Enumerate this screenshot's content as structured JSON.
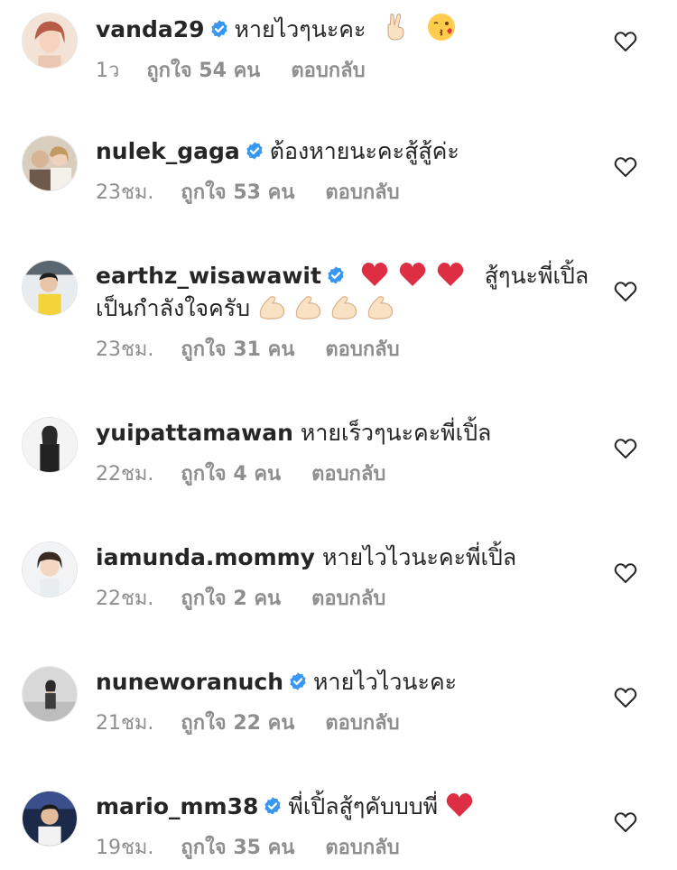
{
  "comments": [
    {
      "username": "vanda29",
      "verified": true,
      "text": "หายไวๆนะคะ",
      "emojis": [
        "victory-hand",
        "kiss-face"
      ],
      "time": "1ว",
      "likes": "ถูกใจ 54 คน",
      "reply": "ตอบกลับ"
    },
    {
      "username": "nulek_gaga",
      "verified": true,
      "text": "ต้องหายนะคะสู้สู้ค่ะ",
      "emojis": [],
      "time": "23ชม.",
      "likes": "ถูกใจ 53 คน",
      "reply": "ตอบกลับ"
    },
    {
      "username": "earthz_wisawawit",
      "verified": true,
      "text": "สู้ๆนะพี่เปิ้ล",
      "text_line2": "เป็นกำลังใจครับ",
      "emojis": [
        "red-heart",
        "red-heart",
        "red-heart"
      ],
      "emojis_line2": [
        "flexed-biceps",
        "flexed-biceps",
        "flexed-biceps",
        "flexed-biceps"
      ],
      "time": "23ชม.",
      "likes": "ถูกใจ 31 คน",
      "reply": "ตอบกลับ"
    },
    {
      "username": "yuipattamawan",
      "verified": false,
      "text": "หายเร็วๆนะคะพี่เปิ้ล",
      "emojis": [],
      "time": "22ชม.",
      "likes": "ถูกใจ 4 คน",
      "reply": "ตอบกลับ"
    },
    {
      "username": "iamunda.mommy",
      "verified": false,
      "text": "หายไวไวนะคะพี่เปิ้ล",
      "emojis": [],
      "time": "22ชม.",
      "likes": "ถูกใจ 2 คน",
      "reply": "ตอบกลับ"
    },
    {
      "username": "nuneworanuch",
      "verified": true,
      "text": "หายไวไวนะคะ",
      "emojis": [],
      "time": "21ชม.",
      "likes": "ถูกใจ 22 คน",
      "reply": "ตอบกลับ"
    },
    {
      "username": "mario_mm38",
      "verified": true,
      "text": "พี่เปิ้ลสู้ๆคับบบพี่",
      "emojis": [
        "red-heart"
      ],
      "time": "19ชม.",
      "likes": "ถูกใจ 35 คน",
      "reply": "ตอบกลับ"
    }
  ],
  "colors": {
    "text": "#262626",
    "secondary": "#8e8e8e",
    "verified": "#3897f0",
    "heart_outline": "#262626"
  }
}
